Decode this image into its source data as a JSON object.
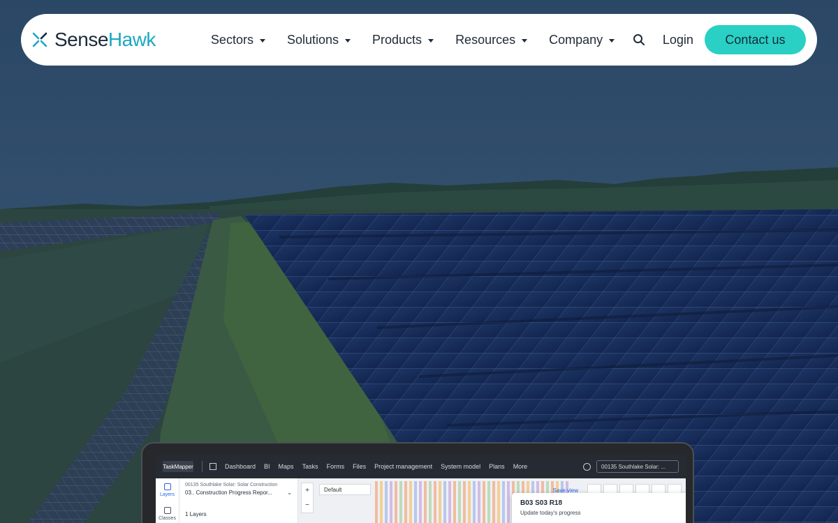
{
  "brand": {
    "name_part1": "Sense",
    "name_part2": "Hawk",
    "accent_color": "#2ad0c4",
    "logo_color": "#1aa8c1"
  },
  "nav": {
    "menu": [
      {
        "label": "Sectors"
      },
      {
        "label": "Solutions"
      },
      {
        "label": "Products"
      },
      {
        "label": "Resources"
      },
      {
        "label": "Company"
      }
    ],
    "search_icon": "search-icon",
    "login_label": "Login",
    "contact_label": "Contact us"
  },
  "app": {
    "logo_text": "TaskMapper",
    "tabs": [
      "Dashboard",
      "BI",
      "Maps",
      "Tasks",
      "Forms",
      "Files",
      "Project management",
      "System model",
      "Plans",
      "More"
    ],
    "project_pill": "00135 Southlake Solar: ...",
    "left_panel": [
      {
        "label": "Layers"
      },
      {
        "label": "Classes"
      }
    ],
    "mid_panel": {
      "line1": "00135 Southlake Solar: Solar Construction",
      "line2": "03.. Construction Progress Repor...",
      "line3": "1 Layers"
    },
    "map": {
      "layer_select": "Default",
      "save_view": "Save view"
    },
    "popup": {
      "title": "B03 S03 R18",
      "subtitle": "Update today's progress"
    }
  }
}
